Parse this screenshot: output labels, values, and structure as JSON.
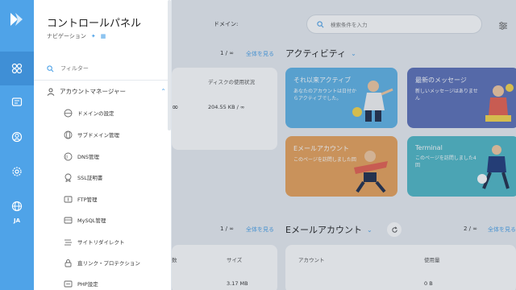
{
  "rail": {
    "items": [
      "dashboard-icon",
      "message-icon",
      "user-icon",
      "gear-icon",
      "globe-icon"
    ],
    "lang": "JA"
  },
  "panel": {
    "title": "コントロールパネル",
    "subtitle": "ナビゲーション",
    "filter_placeholder": "フィルター",
    "group_label": "アカウントマネージャー",
    "items": [
      {
        "label": "ドメインの設定",
        "icon": "domain-settings-icon"
      },
      {
        "label": "サブドメイン管理",
        "icon": "subdomain-icon"
      },
      {
        "label": "DNS管理",
        "icon": "dns-icon"
      },
      {
        "label": "SSL証明書",
        "icon": "ssl-icon"
      },
      {
        "label": "FTP管理",
        "icon": "ftp-icon"
      },
      {
        "label": "MySQL管理",
        "icon": "mysql-icon"
      },
      {
        "label": "サイトリダイレクト",
        "icon": "redirect-icon"
      },
      {
        "label": "直リンク・プロテクション",
        "icon": "lock-icon"
      },
      {
        "label": "PHP設定",
        "icon": "php-icon"
      }
    ]
  },
  "main": {
    "domain_label": "ドメイン:",
    "search_placeholder": "検索条件を入力",
    "domains_count": "1 / ∞",
    "see_all": "全体を見る",
    "disk_header": "ディスクの使用状況",
    "row_inf": "∞",
    "disk_value": "204.55 KB / ∞",
    "activity_title": "アクティビティ",
    "tiles": [
      {
        "title": "それ以来アクティブ",
        "desc": "あなたのアカウントは日付からアクティブでした。",
        "color": "#5fb3e6"
      },
      {
        "title": "最新のメッセージ",
        "desc": "新しいメッセージはありません",
        "color": "#5b6fb8"
      },
      {
        "title": "Eメールアカウント",
        "desc": "このページを訪問しました回",
        "color": "#e8a25a"
      },
      {
        "title": "Terminal",
        "desc": "このページを訪問しました4回",
        "color": "#4fb8c6"
      }
    ],
    "bottom_left_count": "1 / ∞",
    "bottom_left_seeall": "全体を見る",
    "email_title": "Eメールアカウント",
    "email_count": "2 / ∞",
    "email_seeall": "全体を見る",
    "bl_header_count": "数",
    "bl_header_size": "サイズ",
    "bl_size_value": "3.17 MB",
    "email_header_account": "アカウント",
    "email_header_usage": "使用量",
    "email_usage_value": "0 B"
  }
}
